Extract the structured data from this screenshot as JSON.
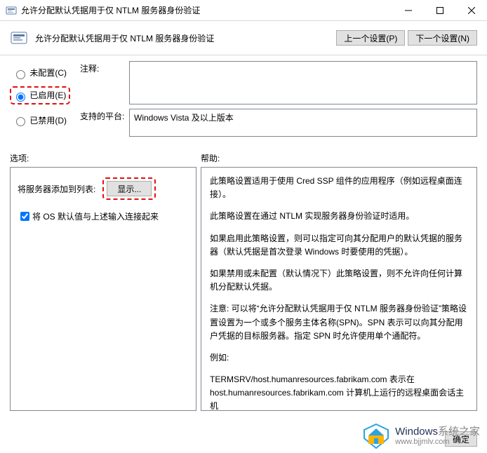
{
  "window": {
    "title": "允许分配默认凭据用于仅 NTLM 服务器身份验证"
  },
  "subheader": {
    "title": "允许分配默认凭据用于仅 NTLM 服务器身份验证",
    "prev_btn": "上一个设置(P)",
    "next_btn": "下一个设置(N)"
  },
  "radios": {
    "not_configured": "未配置(C)",
    "enabled": "已启用(E)",
    "disabled": "已禁用(D)",
    "selected": "enabled"
  },
  "fields": {
    "comment_label": "注释:",
    "comment_value": "",
    "platform_label": "支持的平台:",
    "platform_value": "Windows Vista 及以上版本"
  },
  "sections": {
    "options_label": "选项:",
    "help_label": "帮助:"
  },
  "options_panel": {
    "add_server_label": "将服务器添加到列表:",
    "show_btn": "显示...",
    "link_checkbox_label": "将 OS 默认值与上述输入连接起来",
    "link_checked": true
  },
  "help_text": {
    "p1": "此策略设置适用于使用 Cred SSP 组件的应用程序（例如远程桌面连接）。",
    "p2": "此策略设置在通过 NTLM 实现服务器身份验证时适用。",
    "p3": "如果启用此策略设置，则可以指定可向其分配用户的默认凭据的服务器（默认凭据是首次登录 Windows 时要使用的凭据）。",
    "p4": "如果禁用或未配置（默认情况下）此策略设置，则不允许向任何计算机分配默认凭据。",
    "p5": "注意: 可以将“允许分配默认凭据用于仅 NTLM 服务器身份验证”策略设置设置为一个或多个服务主体名称(SPN)。SPN 表示可以向其分配用户凭据的目标服务器。指定 SPN 时允许使用单个通配符。",
    "p6": "例如:",
    "p7": "TERMSRV/host.humanresources.fabrikam.com 表示在 host.humanresources.fabrikam.com 计算机上运行的远程桌面会话主机"
  },
  "footer": {
    "ok": "确定"
  },
  "watermark": {
    "line1a": "Windows",
    "line1b": "系统之家",
    "line2": "www.bjjmlv.com"
  }
}
